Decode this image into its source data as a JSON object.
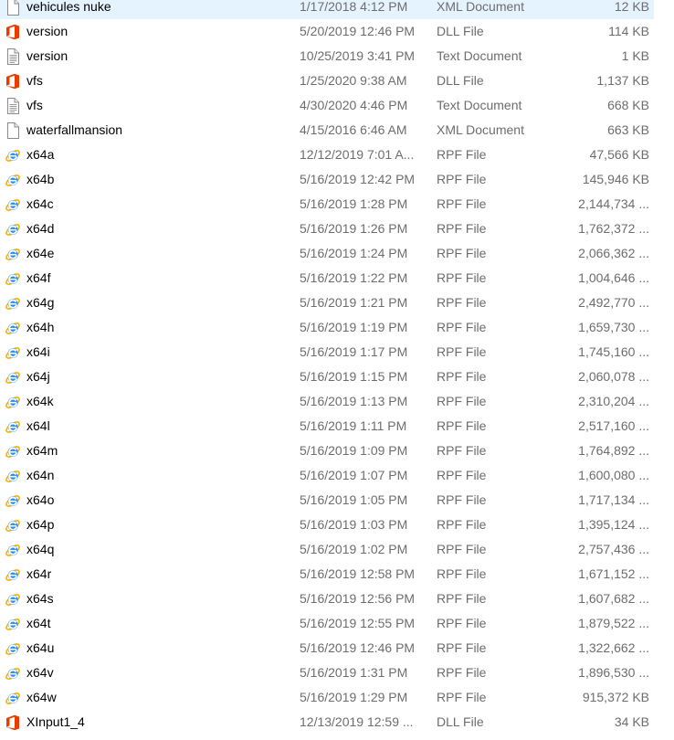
{
  "files": [
    {
      "name": "vehicules nuke",
      "date": "1/17/2018 4:12 PM",
      "type": "XML Document",
      "size": "12 KB",
      "icon": "xml-document-icon"
    },
    {
      "name": "version",
      "date": "5/20/2019 12:46 PM",
      "type": "DLL File",
      "size": "114 KB",
      "icon": "office-dll-icon"
    },
    {
      "name": "version",
      "date": "10/25/2019 3:41 PM",
      "type": "Text Document",
      "size": "1 KB",
      "icon": "text-document-icon"
    },
    {
      "name": "vfs",
      "date": "1/25/2020 9:38 AM",
      "type": "DLL File",
      "size": "1,137 KB",
      "icon": "office-dll-icon"
    },
    {
      "name": "vfs",
      "date": "4/30/2020 4:46 PM",
      "type": "Text Document",
      "size": "668 KB",
      "icon": "text-document-icon"
    },
    {
      "name": "waterfallmansion",
      "date": "4/15/2016 6:46 AM",
      "type": "XML Document",
      "size": "663 KB",
      "icon": "xml-document-icon"
    },
    {
      "name": "x64a",
      "date": "12/12/2019 7:01 A...",
      "type": "RPF File",
      "size": "47,566 KB",
      "icon": "internet-explorer-icon"
    },
    {
      "name": "x64b",
      "date": "5/16/2019 12:42 PM",
      "type": "RPF File",
      "size": "145,946 KB",
      "icon": "internet-explorer-icon"
    },
    {
      "name": "x64c",
      "date": "5/16/2019 1:28 PM",
      "type": "RPF File",
      "size": "2,144,734 ...",
      "icon": "internet-explorer-icon"
    },
    {
      "name": "x64d",
      "date": "5/16/2019 1:26 PM",
      "type": "RPF File",
      "size": "1,762,372 ...",
      "icon": "internet-explorer-icon"
    },
    {
      "name": "x64e",
      "date": "5/16/2019 1:24 PM",
      "type": "RPF File",
      "size": "2,066,362 ...",
      "icon": "internet-explorer-icon"
    },
    {
      "name": "x64f",
      "date": "5/16/2019 1:22 PM",
      "type": "RPF File",
      "size": "1,004,646 ...",
      "icon": "internet-explorer-icon"
    },
    {
      "name": "x64g",
      "date": "5/16/2019 1:21 PM",
      "type": "RPF File",
      "size": "2,492,770 ...",
      "icon": "internet-explorer-icon"
    },
    {
      "name": "x64h",
      "date": "5/16/2019 1:19 PM",
      "type": "RPF File",
      "size": "1,659,730 ...",
      "icon": "internet-explorer-icon"
    },
    {
      "name": "x64i",
      "date": "5/16/2019 1:17 PM",
      "type": "RPF File",
      "size": "1,745,160 ...",
      "icon": "internet-explorer-icon"
    },
    {
      "name": "x64j",
      "date": "5/16/2019 1:15 PM",
      "type": "RPF File",
      "size": "2,060,078 ...",
      "icon": "internet-explorer-icon"
    },
    {
      "name": "x64k",
      "date": "5/16/2019 1:13 PM",
      "type": "RPF File",
      "size": "2,310,204 ...",
      "icon": "internet-explorer-icon"
    },
    {
      "name": "x64l",
      "date": "5/16/2019 1:11 PM",
      "type": "RPF File",
      "size": "2,517,160 ...",
      "icon": "internet-explorer-icon"
    },
    {
      "name": "x64m",
      "date": "5/16/2019 1:09 PM",
      "type": "RPF File",
      "size": "1,764,892 ...",
      "icon": "internet-explorer-icon"
    },
    {
      "name": "x64n",
      "date": "5/16/2019 1:07 PM",
      "type": "RPF File",
      "size": "1,600,080 ...",
      "icon": "internet-explorer-icon"
    },
    {
      "name": "x64o",
      "date": "5/16/2019 1:05 PM",
      "type": "RPF File",
      "size": "1,717,134 ...",
      "icon": "internet-explorer-icon"
    },
    {
      "name": "x64p",
      "date": "5/16/2019 1:03 PM",
      "type": "RPF File",
      "size": "1,395,124 ...",
      "icon": "internet-explorer-icon"
    },
    {
      "name": "x64q",
      "date": "5/16/2019 1:02 PM",
      "type": "RPF File",
      "size": "2,757,436 ...",
      "icon": "internet-explorer-icon"
    },
    {
      "name": "x64r",
      "date": "5/16/2019 12:58 PM",
      "type": "RPF File",
      "size": "1,671,152 ...",
      "icon": "internet-explorer-icon"
    },
    {
      "name": "x64s",
      "date": "5/16/2019 12:56 PM",
      "type": "RPF File",
      "size": "1,607,682 ...",
      "icon": "internet-explorer-icon"
    },
    {
      "name": "x64t",
      "date": "5/16/2019 12:55 PM",
      "type": "RPF File",
      "size": "1,879,522 ...",
      "icon": "internet-explorer-icon"
    },
    {
      "name": "x64u",
      "date": "5/16/2019 12:46 PM",
      "type": "RPF File",
      "size": "1,322,662 ...",
      "icon": "internet-explorer-icon"
    },
    {
      "name": "x64v",
      "date": "5/16/2019 1:31 PM",
      "type": "RPF File",
      "size": "1,896,530 ...",
      "icon": "internet-explorer-icon"
    },
    {
      "name": "x64w",
      "date": "5/16/2019 1:29 PM",
      "type": "RPF File",
      "size": "915,372 KB",
      "icon": "internet-explorer-icon"
    },
    {
      "name": "XInput1_4",
      "date": "12/13/2019 12:59 ...",
      "type": "DLL File",
      "size": "34 KB",
      "icon": "office-dll-icon"
    }
  ]
}
